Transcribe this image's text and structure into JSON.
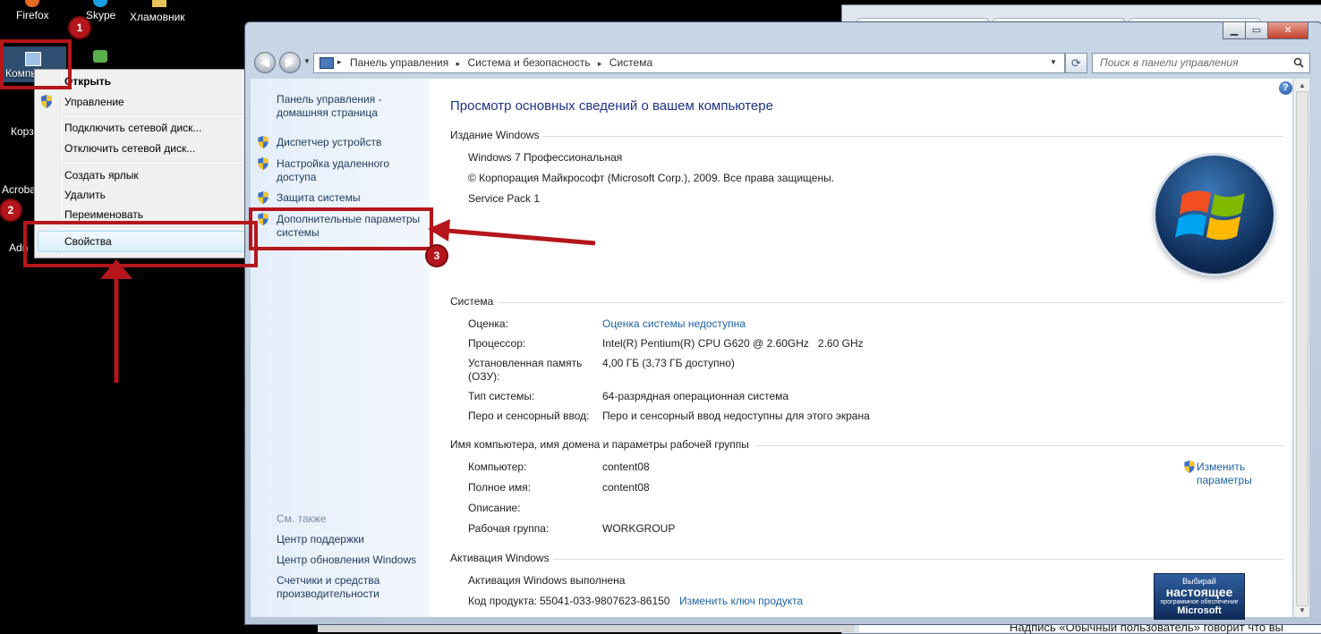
{
  "desktop": {
    "icons": [
      {
        "label": "Firefox"
      },
      {
        "label": "Skype"
      },
      {
        "label": "Хламовник"
      },
      {
        "label": "Компь"
      },
      {
        "label": "Корз"
      },
      {
        "label": "Acroba"
      },
      {
        "label": "Adn"
      }
    ]
  },
  "context_menu": {
    "items": [
      "Открыть",
      "Управление",
      "Подключить сетевой диск...",
      "Отключить сетевой диск...",
      "Создать ярлык",
      "Удалить",
      "Переименовать",
      "Свойства"
    ],
    "highlighted": "Свойства"
  },
  "window": {
    "address": {
      "crumbs": [
        "Панель управления",
        "Система и безопасность",
        "Система"
      ],
      "separator": "▸"
    },
    "search_placeholder": "Поиск в панели управления",
    "caption_buttons": {
      "minimize": "▁",
      "maximize": "▭",
      "close": "✕"
    },
    "left_pane": {
      "home_link": "Панель управления - домашняя страница",
      "links": [
        "Диспетчер устройств",
        "Настройка удаленного доступа",
        "Защита системы",
        "Дополнительные параметры системы"
      ],
      "see_also_label": "См. также",
      "see_also_links": [
        "Центр поддержки",
        "Центр обновления Windows",
        "Счетчики и средства производительности"
      ]
    },
    "content": {
      "title": "Просмотр основных сведений о вашем компьютере",
      "edition": {
        "heading": "Издание Windows",
        "name": "Windows 7 Профессиональная",
        "copyright": "© Корпорация Майкрософт (Microsoft Corp.), 2009. Все права защищены.",
        "service_pack": "Service Pack 1"
      },
      "system": {
        "heading": "Система",
        "rows": [
          {
            "label": "Оценка:",
            "value": "Оценка системы недоступна"
          },
          {
            "label": "Процессор:",
            "value": "Intel(R) Pentium(R) CPU G620 @ 2.60GHz   2.60 GHz"
          },
          {
            "label": "Установленная память (ОЗУ):",
            "value": "4,00 ГБ (3,73 ГБ доступно)"
          },
          {
            "label": "Тип системы:",
            "value": "64-разрядная операционная система"
          },
          {
            "label": "Перо и сенсорный ввод:",
            "value": "Перо и сенсорный ввод недоступны для этого экрана"
          }
        ]
      },
      "computer_name": {
        "heading": "Имя компьютера, имя домена и параметры рабочей группы",
        "rows": [
          {
            "label": "Компьютер:",
            "value": "content08"
          },
          {
            "label": "Полное имя:",
            "value": "content08"
          },
          {
            "label": "Описание:",
            "value": ""
          },
          {
            "label": "Рабочая группа:",
            "value": "WORKGROUP"
          }
        ],
        "change_link": "Изменить параметры"
      },
      "activation": {
        "heading": "Активация Windows",
        "status": "Активация Windows выполнена",
        "product_key_label": "Код продукта:",
        "product_key": "55041-033-9807623-86150",
        "change_key_link": "Изменить ключ продукта"
      },
      "genuine_badge": {
        "line1": "Выбирай",
        "line2": "настоящее",
        "line3": "программное обеспечение",
        "line4": "Microsoft"
      }
    }
  },
  "annotations": {
    "markers": [
      "1",
      "2",
      "3"
    ],
    "color": "#b5161b"
  },
  "background": {
    "bottom_text": "Надпись «Обычный пользователь» говорит что вы"
  },
  "colors": {
    "link": "#1c63a5",
    "title": "#1e3287",
    "annotation": "#b5161b"
  }
}
